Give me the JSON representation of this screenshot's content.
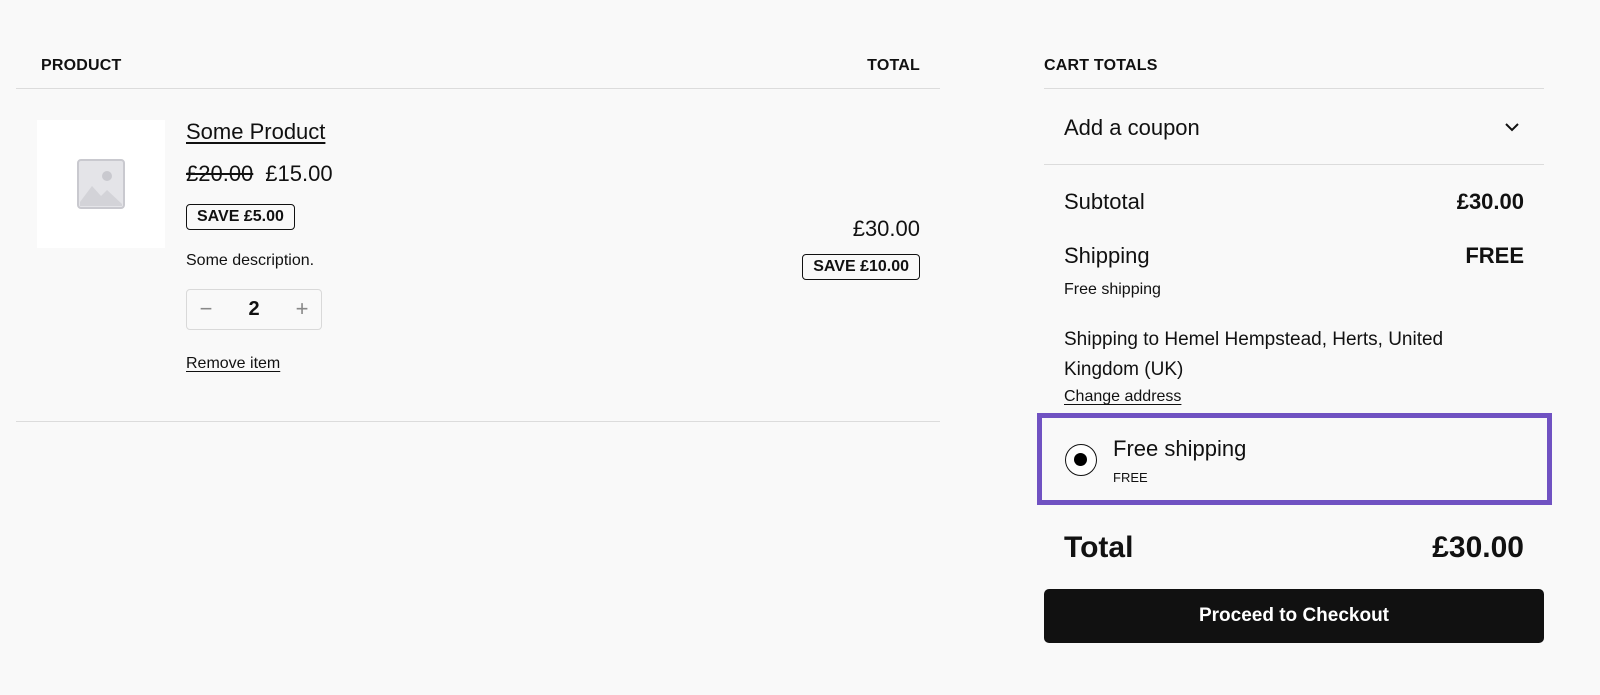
{
  "cart": {
    "col_product": "PRODUCT",
    "col_total": "TOTAL",
    "item": {
      "name": "Some Product",
      "regular_price": "£20.00",
      "sale_price": "£15.00",
      "save_label": "SAVE £5.00",
      "description": "Some description.",
      "quantity": "2",
      "remove_label": "Remove item",
      "line_total": "£30.00",
      "line_save_label": "SAVE £10.00",
      "thumbnail_icon": "image-placeholder-icon"
    }
  },
  "totals": {
    "heading": "CART TOTALS",
    "coupon_label": "Add a coupon",
    "subtotal_label": "Subtotal",
    "subtotal_value": "£30.00",
    "shipping_label": "Shipping",
    "shipping_value": "FREE",
    "shipping_method": "Free shipping",
    "shipping_to": "Shipping to Hemel Hempstead, Herts, United Kingdom (UK)",
    "change_address": "Change address",
    "option": {
      "label": "Free shipping",
      "price": "FREE",
      "selected": true
    },
    "total_label": "Total",
    "total_value": "£30.00",
    "checkout_label": "Proceed to Checkout"
  },
  "colors": {
    "highlight_border": "#7052c2",
    "button_bg": "#111111"
  }
}
